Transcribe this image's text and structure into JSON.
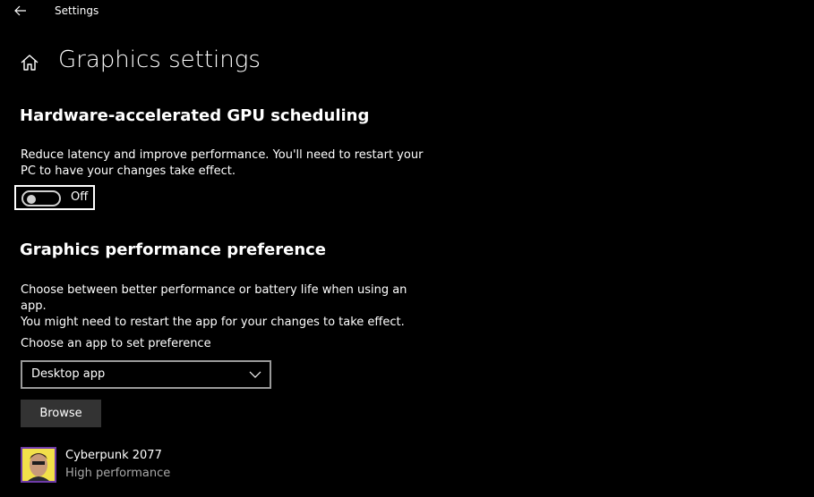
{
  "window": {
    "title": "Settings"
  },
  "header": {
    "page_title": "Graphics settings"
  },
  "gpu_scheduling": {
    "title": "Hardware-accelerated GPU scheduling",
    "description_line1": "Reduce latency and improve performance. You'll need to restart your",
    "description_line2": "PC to have your changes take effect.",
    "toggle_state": "Off"
  },
  "performance_pref": {
    "title": "Graphics performance preference",
    "description_line1": "Choose between better performance or battery life when using an app.",
    "description_line2": "You might need to restart the app for your changes to take effect.",
    "select_label": "Choose an app to set preference",
    "select_value": "Desktop app",
    "browse_label": "Browse"
  },
  "apps": [
    {
      "name": "Cyberpunk 2077",
      "preference": "High performance"
    }
  ],
  "icons": {
    "back": "back-arrow-icon",
    "home": "home-icon",
    "chevron": "chevron-down-icon",
    "app": "cyberpunk-app-icon"
  },
  "colors": {
    "background": "#000000",
    "text": "#ffffff",
    "secondary_text": "#a8a8a8",
    "button_bg": "#333333",
    "app_icon_bg": "#6e3ba8"
  }
}
